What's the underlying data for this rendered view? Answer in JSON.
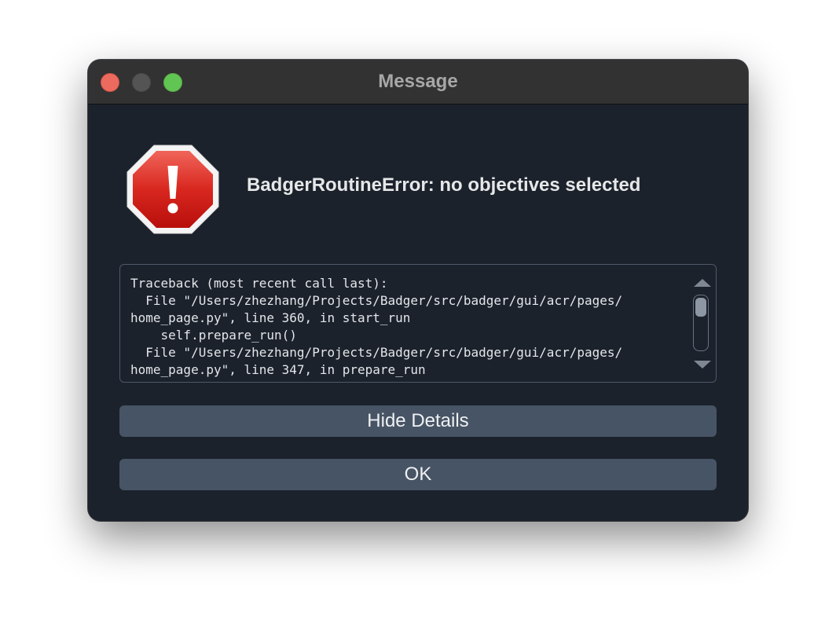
{
  "window": {
    "title": "Message"
  },
  "icons": {
    "traffic_close": "close-icon",
    "traffic_minimize": "minimize-icon",
    "traffic_zoom": "zoom-icon",
    "error": "error-stop-icon",
    "scroll_up": "arrow-up-icon",
    "scroll_down": "arrow-down-icon"
  },
  "colors": {
    "close": "#ed6a5e",
    "minimize": "#545454",
    "zoom": "#61c554",
    "error_red": "#d3231e",
    "window_bg": "#1b222c",
    "button_bg": "#475465"
  },
  "message": {
    "text": "BadgerRoutineError: no objectives selected"
  },
  "details": {
    "text": "Traceback (most recent call last):\n  File \"/Users/zhezhang/Projects/Badger/src/badger/gui/acr/pages/\nhome_page.py\", line 360, in start_run\n    self.prepare_run()\n  File \"/Users/zhezhang/Projects/Badger/src/badger/gui/acr/pages/\nhome_page.py\", line 347, in prepare_run"
  },
  "buttons": {
    "hide_details": "Hide Details",
    "ok": "OK"
  }
}
